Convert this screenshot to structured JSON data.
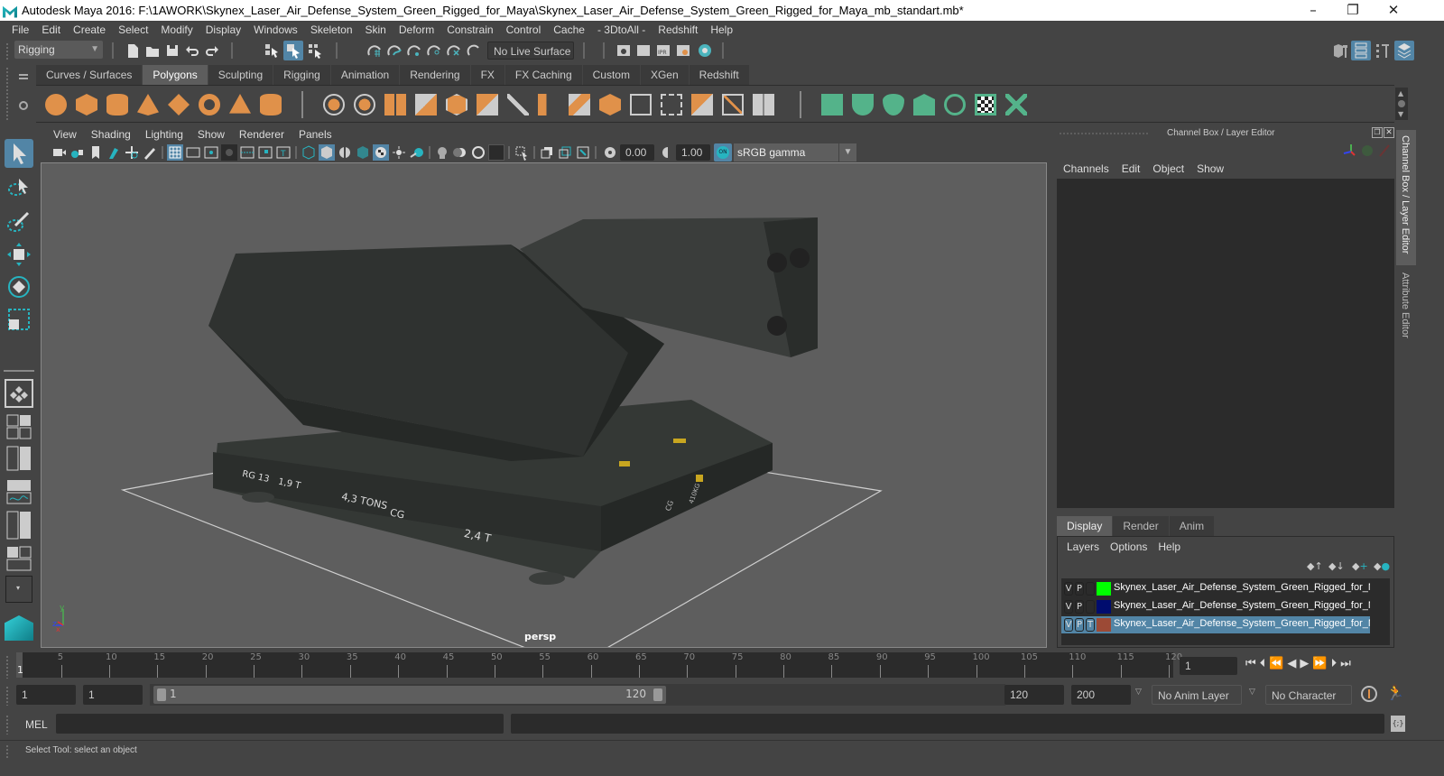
{
  "window": {
    "title": "Autodesk Maya 2016: F:\\1AWORK\\Skynex_Laser_Air_Defense_System_Green_Rigged_for_Maya\\Skynex_Laser_Air_Defense_System_Green_Rigged_for_Maya_mb_standart.mb*",
    "controls": {
      "minimize": "–",
      "restore": "❐",
      "close": "✕"
    }
  },
  "menubar": [
    "File",
    "Edit",
    "Create",
    "Select",
    "Modify",
    "Display",
    "Windows",
    "Skeleton",
    "Skin",
    "Deform",
    "Constrain",
    "Control",
    "Cache",
    "- 3DtoAll -",
    "Redshift",
    "Help"
  ],
  "statusline": {
    "menuset": "Rigging",
    "live_surface": "No Live Surface"
  },
  "shelf": {
    "tabs": [
      "Curves / Surfaces",
      "Polygons",
      "Sculpting",
      "Rigging",
      "Animation",
      "Rendering",
      "FX",
      "FX Caching",
      "Custom",
      "XGen",
      "Redshift"
    ],
    "active_tab": "Polygons",
    "poly_prims": [
      "poly-sphere-icon",
      "poly-cube-icon",
      "poly-cylinder-icon",
      "poly-cone-icon",
      "poly-plane-icon",
      "poly-torus-icon",
      "poly-pyramid-icon",
      "poly-pipe-icon"
    ],
    "poly_tools": [
      "combine-icon",
      "separate-icon",
      "mirror-icon",
      "smooth-icon",
      "boolean-icon",
      "reduce-icon",
      "multicut-icon",
      "extrude-icon",
      "bridge-icon",
      "bevel-icon",
      "insert-edge-loop-icon",
      "offset-edge-loop-icon",
      "fill-hole-icon",
      "target-weld-icon",
      "merge-icon",
      "append-polygon-icon"
    ],
    "uv_tools": [
      "planar-map-icon",
      "cylindrical-map-icon",
      "spherical-map-icon",
      "automatic-map-icon",
      "unfold-icon",
      "uv-editor-icon",
      "uv-layout-icon"
    ]
  },
  "viewport": {
    "menu": [
      "View",
      "Shading",
      "Lighting",
      "Show",
      "Renderer",
      "Panels"
    ],
    "exposure": "0.00",
    "gamma": "1.00",
    "colorspace_toggle": "ON",
    "colorspace": "sRGB gamma",
    "camera_label": "persp",
    "axis": {
      "x": "x",
      "y": "y",
      "z": "z"
    },
    "model_labels": [
      "RG 13",
      "1,9 T",
      "4,3 TONS",
      "CG",
      "2,4 T",
      "CG",
      "410KG"
    ]
  },
  "channelbox": {
    "title": "Channel Box / Layer Editor",
    "menu": [
      "Channels",
      "Edit",
      "Object",
      "Show"
    ]
  },
  "layereditor": {
    "tabs": [
      "Display",
      "Render",
      "Anim"
    ],
    "active_tab": "Display",
    "menu": [
      "Layers",
      "Options",
      "Help"
    ],
    "layers": [
      {
        "v": "V",
        "p": "P",
        "t": "",
        "color": "#00ff00",
        "name": "Skynex_Laser_Air_Defense_System_Green_Rigged_for_Ma",
        "selected": false
      },
      {
        "v": "V",
        "p": "P",
        "t": "",
        "color": "#000c6e",
        "name": "Skynex_Laser_Air_Defense_System_Green_Rigged_for_Ma",
        "selected": false
      },
      {
        "v": "V",
        "p": "P",
        "t": "T",
        "color": "#9c4a36",
        "name": "Skynex_Laser_Air_Defense_System_Green_Rigged_for_Ma",
        "selected": true
      }
    ]
  },
  "sidetabs": [
    "Channel Box / Layer Editor",
    "Attribute Editor"
  ],
  "timeline": {
    "ticks": [
      "5",
      "10",
      "15",
      "20",
      "25",
      "30",
      "35",
      "40",
      "45",
      "50",
      "55",
      "60",
      "65",
      "70",
      "75",
      "80",
      "85",
      "90",
      "95",
      "100",
      "105",
      "110",
      "115",
      "120"
    ],
    "current_frame_marker": "1",
    "current_frame": "1"
  },
  "range": {
    "start": "1",
    "playback_start": "1",
    "slider_min": "1",
    "slider_max": "120",
    "playback_end": "120",
    "end": "200",
    "anim_layer": "No Anim Layer",
    "character_set": "No Character Set"
  },
  "cmdline": {
    "label": "MEL",
    "value": "",
    "result": ""
  },
  "helpline": {
    "text": "Select Tool: select an object"
  },
  "colors": {
    "accent": "#5285a6",
    "selected_layer": "#5285a6",
    "shelf_orange": "#e0914a",
    "shelf_green": "#54b38a",
    "maya_teal": "#1fb7c0"
  }
}
